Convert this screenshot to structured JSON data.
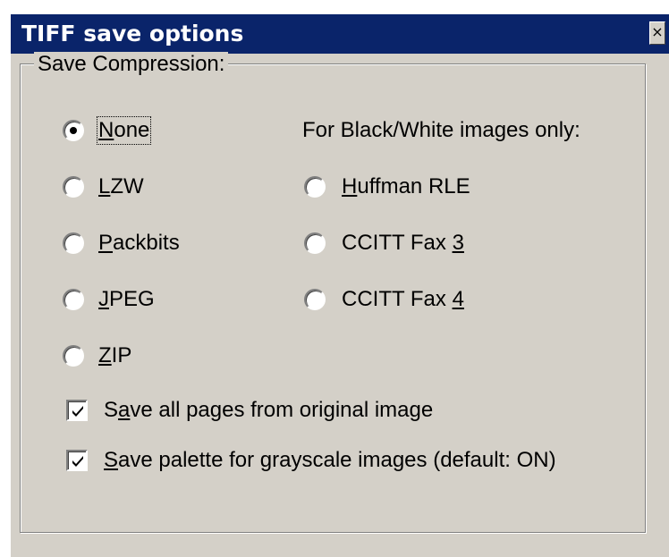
{
  "window": {
    "title": "TIFF save options",
    "close_glyph": "×"
  },
  "group": {
    "legend": "Save Compression:"
  },
  "compression": {
    "options": [
      {
        "pre": "",
        "key": "N",
        "post": "one",
        "checked": true
      },
      {
        "pre": "",
        "key": "L",
        "post": "ZW",
        "checked": false
      },
      {
        "pre": "",
        "key": "P",
        "post": "ackbits",
        "checked": false
      },
      {
        "pre": "",
        "key": "J",
        "post": "PEG",
        "checked": false
      },
      {
        "pre": "",
        "key": "Z",
        "post": "IP",
        "checked": false
      }
    ]
  },
  "bw": {
    "heading": "For Black/White images only:",
    "options": [
      {
        "pre": "",
        "key": "H",
        "post": "uffman RLE",
        "checked": false
      },
      {
        "pre": "CCITT Fax ",
        "key": "3",
        "post": "",
        "checked": false
      },
      {
        "pre": "CCITT Fax ",
        "key": "4",
        "post": "",
        "checked": false
      }
    ]
  },
  "checks": [
    {
      "pre": "S",
      "key": "a",
      "post": "ve all pages from original image",
      "checked": true
    },
    {
      "pre": "",
      "key": "S",
      "post": "ave palette for grayscale images (default: ON)",
      "checked": true
    }
  ],
  "icons": {
    "close": "close-icon",
    "radio_selected": "radio-dot-icon",
    "checkmark": "checkmark-icon"
  }
}
